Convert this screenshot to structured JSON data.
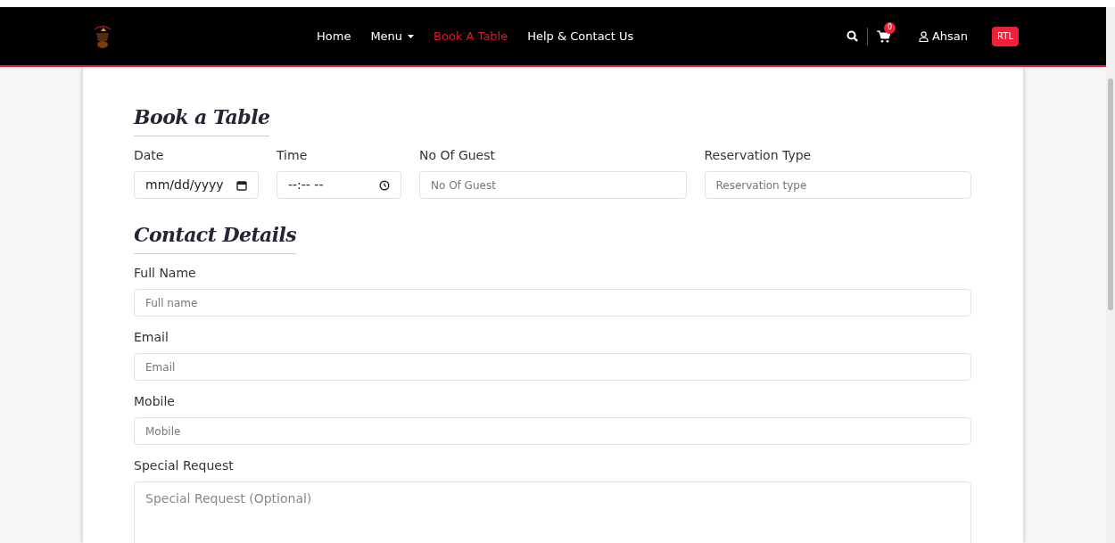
{
  "navbar": {
    "links": [
      {
        "label": "Home",
        "selected": false,
        "dropdown": false
      },
      {
        "label": "Menu",
        "selected": false,
        "dropdown": true
      },
      {
        "label": "Book A Table",
        "selected": true,
        "dropdown": false
      },
      {
        "label": "Help & Contact Us",
        "selected": false,
        "dropdown": false
      }
    ],
    "cart_count": "0",
    "user": "Ahsan",
    "rtl_button": "RTL"
  },
  "booking": {
    "title": "Book a Table",
    "fields": [
      {
        "kind": "date",
        "label": "Date",
        "value": "mm/dd/yyyy"
      },
      {
        "kind": "time",
        "label": "Time",
        "value": "--:-- --"
      },
      {
        "kind": "text",
        "label": "No Of Guest",
        "placeholder": "No Of Guest"
      },
      {
        "kind": "text",
        "label": "Reservation Type",
        "placeholder": "Reservation type"
      }
    ]
  },
  "contact": {
    "title": "Contact Details",
    "fields": [
      {
        "kind": "text",
        "label": "Full Name",
        "placeholder": "Full name"
      },
      {
        "kind": "text",
        "label": "Email",
        "placeholder": "Email"
      },
      {
        "kind": "text",
        "label": "Mobile",
        "placeholder": "Mobile"
      },
      {
        "kind": "textarea",
        "label": "Special Request",
        "placeholder": "Special Request (Optional)"
      }
    ]
  }
}
